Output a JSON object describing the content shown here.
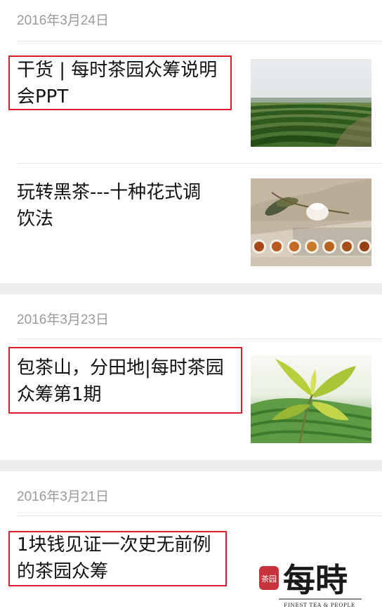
{
  "groups": [
    {
      "date": "2016年3月24日",
      "items": [
        {
          "title_lines": [
            "干货 | 每时茶园众筹说明",
            "会PPT"
          ],
          "highlighted": true,
          "thumbnail": "tea-plantation-rows-photo"
        },
        {
          "title_lines": [
            "玩转黑茶---十种花式调",
            "饮法"
          ],
          "highlighted": false,
          "thumbnail": "tea-cups-lotus-photo"
        }
      ]
    },
    {
      "date": "2016年3月23日",
      "items": [
        {
          "title_lines": [
            "包茶山，分田地|每时茶园",
            "众筹第1期"
          ],
          "highlighted": true,
          "thumbnail": "tea-leaf-sprout-photo"
        }
      ]
    },
    {
      "date": "2016年3月21日",
      "items": [
        {
          "title_lines": [
            "1块钱见证一次史无前例",
            "的茶园众筹"
          ],
          "highlighted": true,
          "thumbnail": "meishi-logo",
          "logo": {
            "seal_text": "茶园",
            "main_text": "每時",
            "tagline": "FINEST TEA & PEOPLE"
          }
        }
      ]
    }
  ],
  "colors": {
    "highlight_border": "#d8202a",
    "separator": "#ededed",
    "date_text": "#9a9a9a",
    "title_text": "#111111"
  }
}
